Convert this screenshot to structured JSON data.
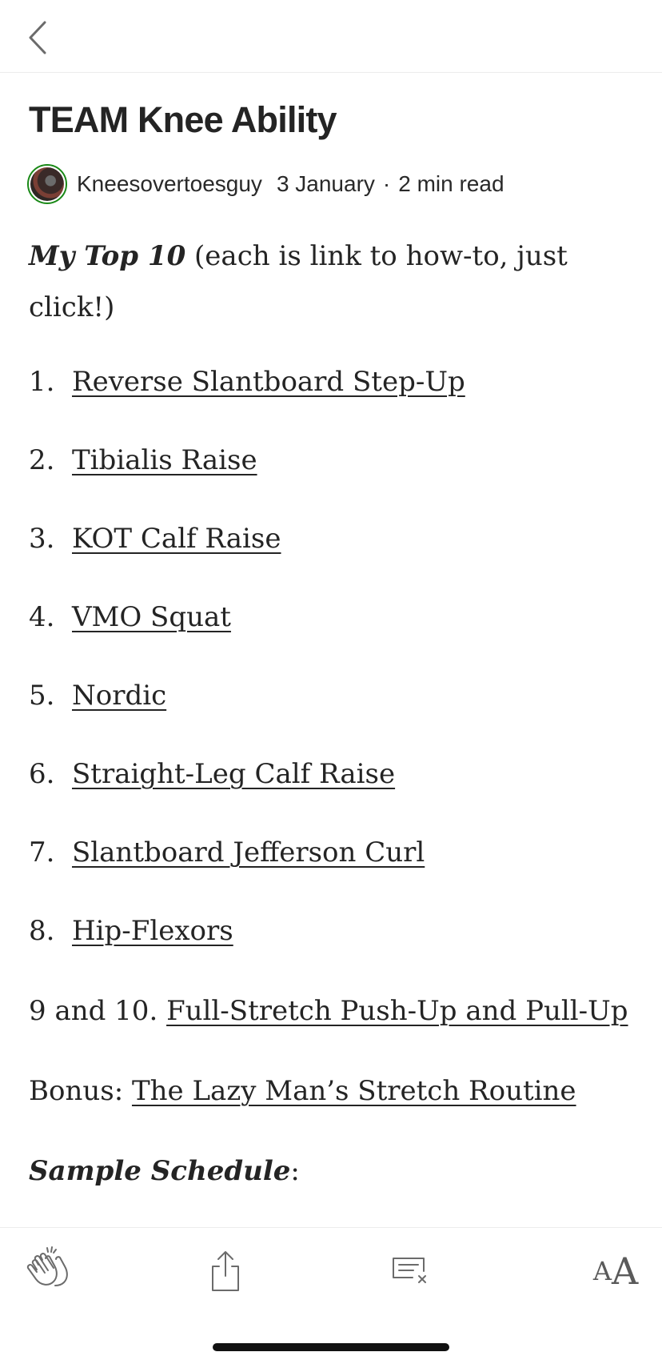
{
  "nav": {
    "back_icon": "chevron-left-icon"
  },
  "article": {
    "title": "TEAM Knee Ability",
    "author": "Kneesovertoesguy",
    "date": "3 January",
    "separator": "·",
    "read_time": "2 min read",
    "intro_emphasis": "My Top 10",
    "intro_rest_line1": " (each is link to how-to, just",
    "intro_rest_line2": "click!)",
    "list": [
      {
        "num": "1.",
        "label": "Reverse Slantboard Step-Up"
      },
      {
        "num": "2.",
        "label": "Tibialis Raise"
      },
      {
        "num": "3.",
        "label": "KOT Calf Raise"
      },
      {
        "num": "4.",
        "label": "VMO Squat"
      },
      {
        "num": "5.",
        "label": "Nordic"
      },
      {
        "num": "6.",
        "label": "Straight-Leg Calf Raise"
      },
      {
        "num": "7.",
        "label": "Slantboard Jefferson Curl"
      },
      {
        "num": "8.",
        "label": "Hip-Flexors"
      }
    ],
    "item_9_10_prefix": "9 and 10. ",
    "item_9_10_label": "Full-Stretch Push-Up and Pull-Up",
    "bonus_prefix": "Bonus: ",
    "bonus_label": "The Lazy Man’s Stretch Routine",
    "schedule_label": "Sample Schedule",
    "schedule_colon": ":"
  },
  "toolbar": {
    "clap_icon": "clap-icon",
    "share_icon": "share-icon",
    "responses_icon": "responses-icon",
    "text_size_small": "A",
    "text_size_large": "A"
  }
}
